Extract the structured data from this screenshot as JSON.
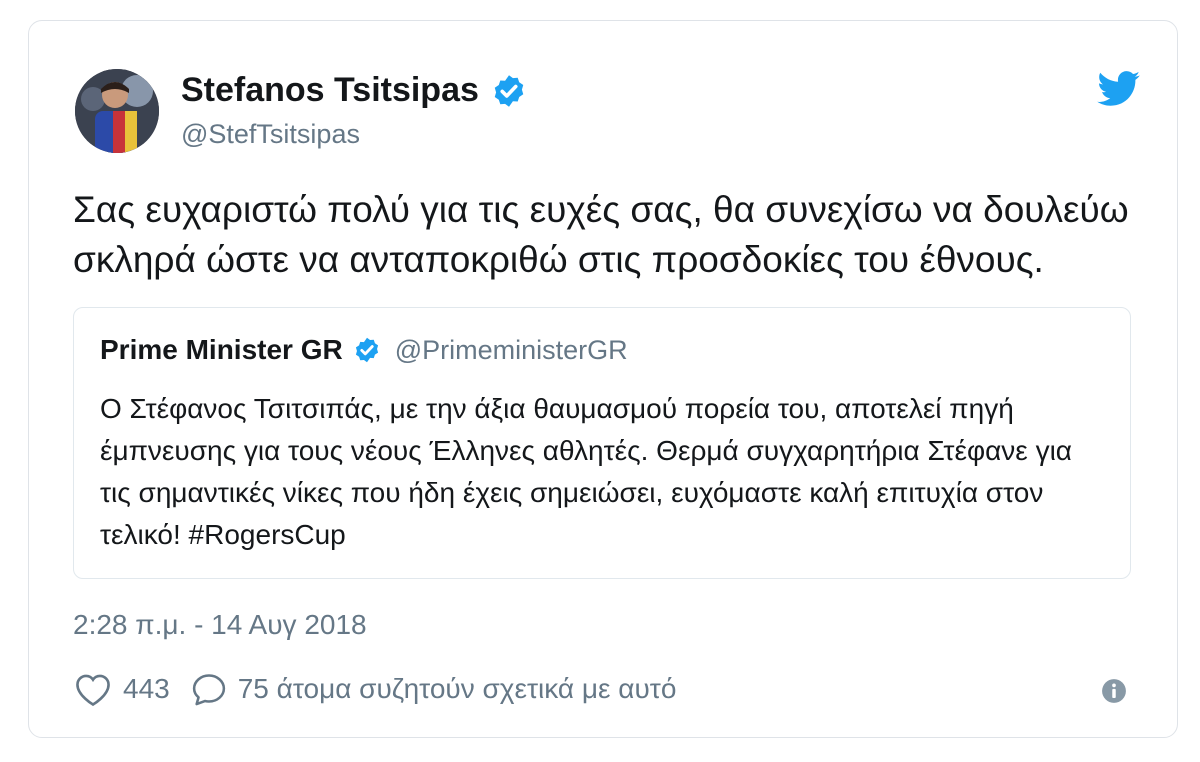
{
  "tweet": {
    "author": {
      "name": "Stefanos Tsitsipas",
      "handle": "@StefTsitsipas",
      "verified": true
    },
    "text": "Σας ευχαριστώ πολύ για τις ευχές σας, θα συνεχίσω να δουλεύω σκληρά ώστε να ανταποκριθώ στις προσδοκίες του έθνους.",
    "quoted": {
      "name": "Prime Minister GR",
      "handle": "@PrimeministerGR",
      "verified": true,
      "text": "Ο Στέφανος Τσιτσιπάς, με την άξια θαυμασμού πορεία του, αποτελεί πηγή έμπνευσης για τους νέους Έλληνες αθλητές. Θερμά συγχαρητήρια Στέφανε για τις σημαντικές νίκες που ήδη έχεις σημειώσει, ευχόμαστε καλή επιτυχία στον τελικό! #RogersCup"
    },
    "timestamp": "2:28 π.μ. - 14 Αυγ 2018",
    "likes": "443",
    "replies_text": "75 άτομα συζητούν σχετικά με αυτό"
  },
  "icons": {
    "brand": "twitter-bird-icon",
    "verified": "verified-badge-icon",
    "like": "heart-icon",
    "reply": "speech-bubble-icon",
    "info": "info-icon"
  },
  "colors": {
    "twitter_blue": "#1da1f2",
    "text_primary": "#14171a",
    "text_secondary": "#657786"
  }
}
